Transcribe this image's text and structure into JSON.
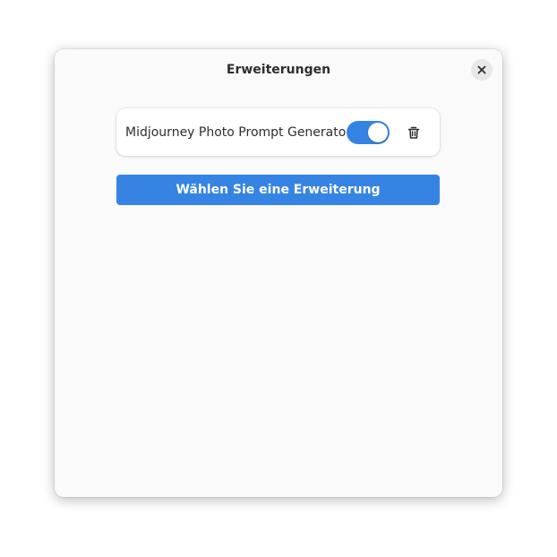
{
  "dialog": {
    "title": "Erweiterungen",
    "close_icon": "close-icon"
  },
  "extensions": [
    {
      "name": "Midjourney Photo Prompt Generator",
      "enabled": true,
      "delete_icon": "trash-icon"
    }
  ],
  "actions": {
    "choose_label": "Wählen Sie eine Erweiterung"
  },
  "colors": {
    "accent": "#3584e4",
    "dialog_background": "#fafafa",
    "row_background": "#ffffff",
    "text": "#2e2e2e"
  }
}
